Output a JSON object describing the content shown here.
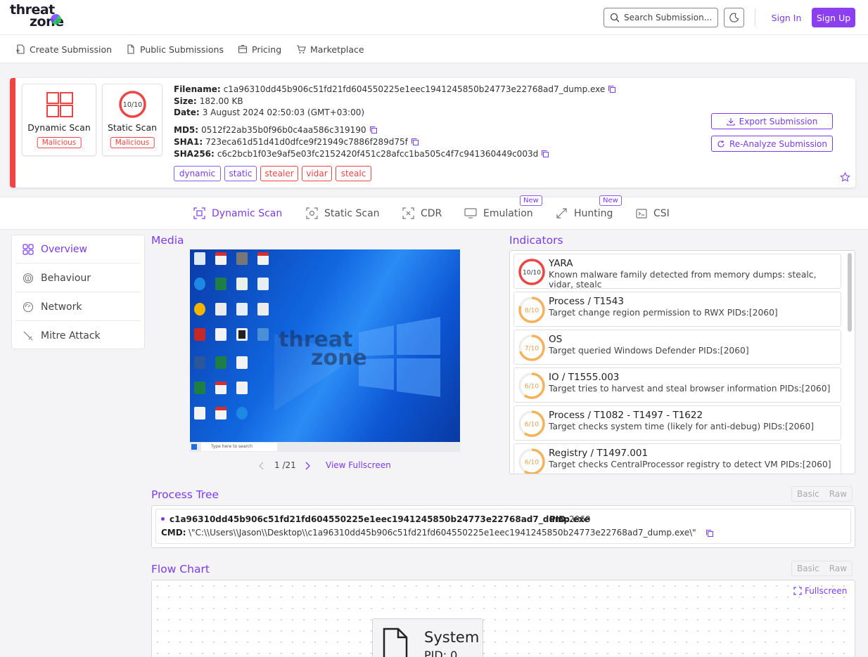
{
  "header": {
    "logo_line1": "threat",
    "logo_line2": "zone",
    "search_placeholder": "Search Submission...",
    "signin_label": "Sign In",
    "signup_label": "Sign Up",
    "accent_color": "#8b3ff0"
  },
  "nav": [
    {
      "label": "Create Submission",
      "icon": "add-file-icon"
    },
    {
      "label": "Public Submissions",
      "icon": "document-icon"
    },
    {
      "label": "Pricing",
      "icon": "pricing-icon"
    },
    {
      "label": "Marketplace",
      "icon": "cart-icon"
    }
  ],
  "summary": {
    "dynamic_label": "Dynamic Scan",
    "dynamic_status": "Malicious",
    "static_label": "Static Scan",
    "static_status": "Malicious",
    "static_score": "10/10",
    "filename_label": "Filename:",
    "filename": "c1a96310dd45b906c51fd21fd604550225e1eec1941245850b24773e22768ad7_dump.exe",
    "size_label": "Size:",
    "size": "182.00 KB",
    "date_label": "Date:",
    "date": "3 August 2024 02:50:03 (GMT+03:00)",
    "md5_label": "MD5:",
    "md5": "0512f22ab35b0f96b0c4aa586c319190",
    "sha1_label": "SHA1:",
    "sha1": "723eca61d51d41d0dfce9f21949c7886f289d75f",
    "sha256_label": "SHA256:",
    "sha256": "c6c2bcb1f03e9af5e03fc2152420f451c28afcc1ba505c4f7c941360449c003d",
    "tags": [
      "dynamic",
      "static",
      "stealer",
      "vidar",
      "stealc"
    ],
    "export_label": "Export Submission",
    "reanalyze_label": "Re-Analyze Submission",
    "danger_color": "#ef4444"
  },
  "tabs": [
    {
      "label": "Dynamic Scan",
      "active": true
    },
    {
      "label": "Static Scan"
    },
    {
      "label": "CDR"
    },
    {
      "label": "Emulation",
      "badge": "New"
    },
    {
      "label": "Hunting",
      "badge": "New"
    },
    {
      "label": "CSI"
    }
  ],
  "sidebar": [
    {
      "label": "Overview",
      "icon": "grid-icon",
      "active": true
    },
    {
      "label": "Behaviour",
      "icon": "fingerprint-icon"
    },
    {
      "label": "Network",
      "icon": "network-icon"
    },
    {
      "label": "Mitre Attack",
      "icon": "sword-icon"
    }
  ],
  "media": {
    "title": "Media",
    "pager": "1 /21",
    "current": 1,
    "total": 21,
    "fullscreen_label": "View Fullscreen",
    "taskbar_search": "Type here to search"
  },
  "indicators": {
    "title": "Indicators",
    "items": [
      {
        "score": "10/10",
        "level": 10,
        "title": "YARA",
        "desc": "Known malware family detected from memory dumps: stealc, vidar, stealc",
        "color": "#ef4444"
      },
      {
        "score": "8/10",
        "level": 8,
        "title": "Process / T1543",
        "desc": "Target change region permission to RWX PIDs:[2060]",
        "color": "#f5b25b"
      },
      {
        "score": "7/10",
        "level": 7,
        "title": "OS",
        "desc": "Target queried Windows Defender PIDs:[2060]",
        "color": "#f5b25b"
      },
      {
        "score": "6/10",
        "level": 6,
        "title": "IO / T1555.003",
        "desc": "Target tries to harvest and steal browser information PIDs:[2060]",
        "color": "#f5b25b"
      },
      {
        "score": "6/10",
        "level": 6,
        "title": "Process / T1082 - T1497 - T1622",
        "desc": "Target checks system time (likely for anti-debug) PIDs:[2060]",
        "color": "#f5b25b"
      },
      {
        "score": "6/10",
        "level": 6,
        "title": "Registry / T1497.001",
        "desc": "Target checks CentralProcessor registry to detect VM PIDs:[2060]",
        "color": "#f5b25b"
      }
    ]
  },
  "process_tree": {
    "title": "Process Tree",
    "toggle_basic": "Basic",
    "toggle_raw": "Raw",
    "process_name": "c1a96310dd45b906c51fd21fd604550225e1eec1941245850b24773e22768ad7_dump.exe",
    "pid_label": "PID:",
    "pid": "2060",
    "cmd_label": "CMD:",
    "cmd": "\\\"C:\\\\Users\\\\Jason\\\\Desktop\\\\c1a96310dd45b906c51fd21fd604550225e1eec1941245850b24773e22768ad7_dump.exe\\\""
  },
  "flow_chart": {
    "title": "Flow Chart",
    "toggle_basic": "Basic",
    "toggle_raw": "Raw",
    "fullscreen_label": "Fullscreen",
    "node_title": "System",
    "node_pid": "PID: 0"
  }
}
